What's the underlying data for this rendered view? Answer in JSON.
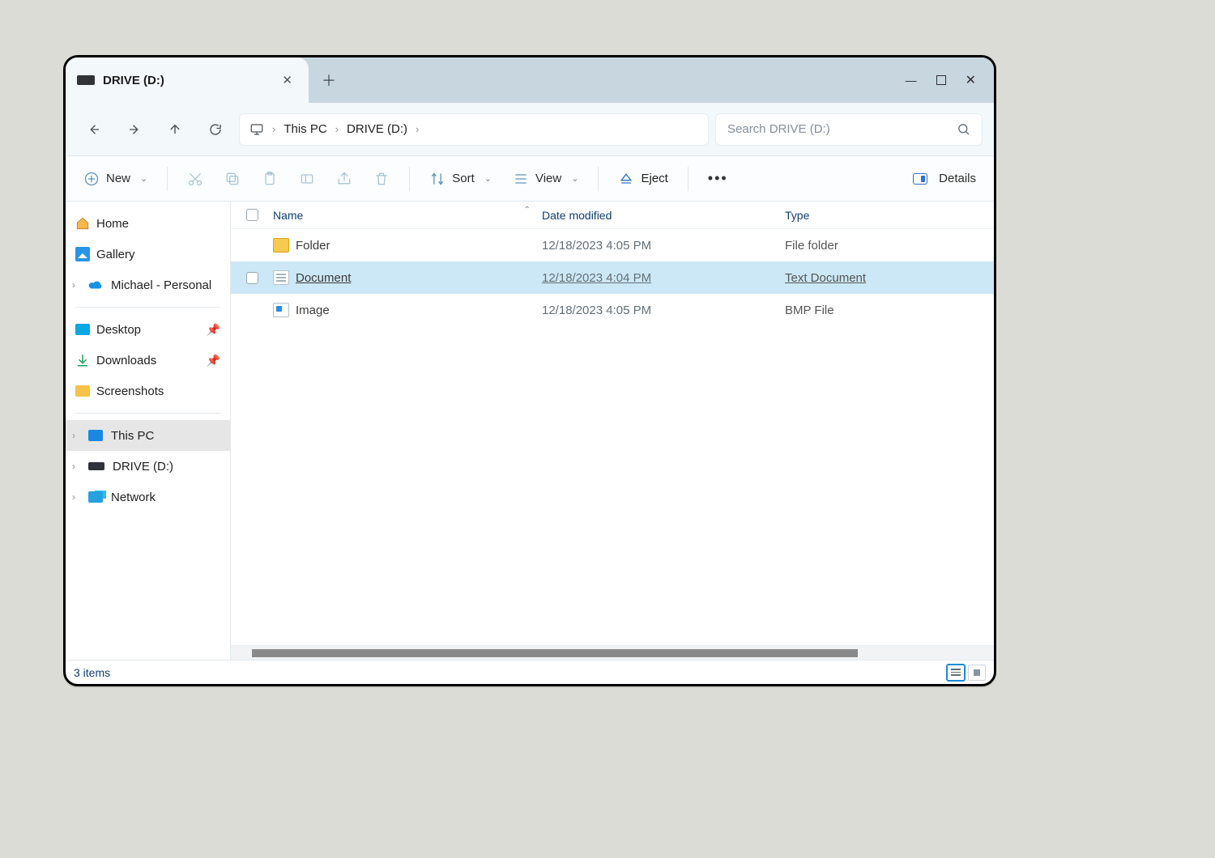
{
  "tab": {
    "title": "DRIVE (D:)"
  },
  "breadcrumb": {
    "root": "This PC",
    "leaf": "DRIVE (D:)"
  },
  "search": {
    "placeholder": "Search DRIVE (D:)"
  },
  "toolbar": {
    "new": "New",
    "sort": "Sort",
    "view": "View",
    "eject": "Eject",
    "details": "Details"
  },
  "sidebar": {
    "home": "Home",
    "gallery": "Gallery",
    "cloud": "Michael - Personal",
    "desktop": "Desktop",
    "downloads": "Downloads",
    "screenshots": "Screenshots",
    "thispc": "This PC",
    "drive": "DRIVE (D:)",
    "network": "Network"
  },
  "columns": {
    "name": "Name",
    "date": "Date modified",
    "type": "Type"
  },
  "rows": [
    {
      "name": "Folder",
      "date": "12/18/2023 4:05 PM",
      "type": "File folder",
      "icon": "folder",
      "selected": false
    },
    {
      "name": "Document",
      "date": "12/18/2023 4:04 PM",
      "type": "Text Document",
      "icon": "doc",
      "selected": true
    },
    {
      "name": "Image",
      "date": "12/18/2023 4:05 PM",
      "type": "BMP File",
      "icon": "img",
      "selected": false
    }
  ],
  "status": {
    "count": "3 items"
  }
}
